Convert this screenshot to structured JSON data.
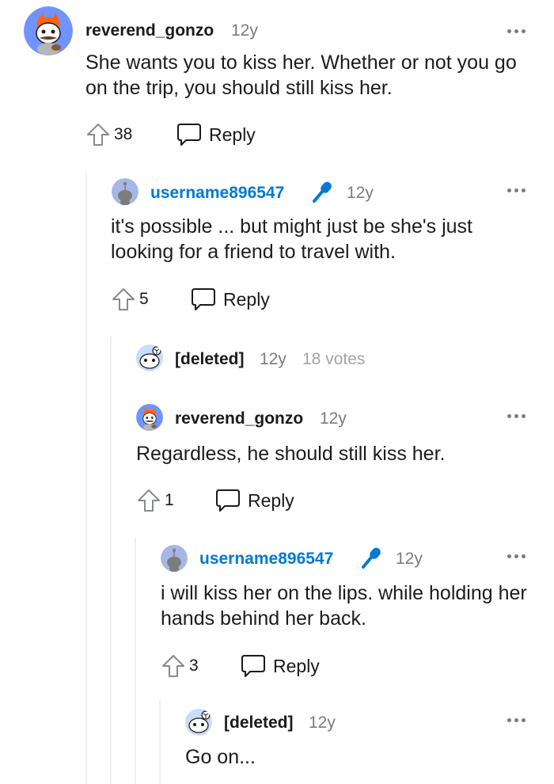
{
  "comments": [
    {
      "username": "reverend_gonzo",
      "time": "12y",
      "body": "She wants you to kiss her. Whether or not you go on the trip, you should still kiss her.",
      "votes": "38",
      "reply_label": "Reply",
      "avatar": "gonzo-avatar"
    },
    {
      "username": "username896547",
      "time": "12y",
      "body": "it's possible ... but might just be she's just looking for a friend to travel with.",
      "votes": "5",
      "reply_label": "Reply",
      "avatar": "snoo-avatar",
      "op": true,
      "flair_icon": "microphone-icon"
    },
    {
      "username": "[deleted]",
      "time": "12y",
      "votes_note": "18 votes",
      "avatar": "deleted-snoo-avatar"
    },
    {
      "username": "reverend_gonzo",
      "time": "12y",
      "body": "Regardless, he should still kiss her.",
      "votes": "1",
      "reply_label": "Reply",
      "avatar": "gonzo-avatar"
    },
    {
      "username": "username896547",
      "time": "12y",
      "body": "i will kiss her on the lips. while holding her hands behind her back.",
      "votes": "3",
      "reply_label": "Reply",
      "avatar": "snoo-avatar",
      "op": true,
      "flair_icon": "microphone-icon"
    },
    {
      "username": "[deleted]",
      "time": "12y",
      "body": "Go on...",
      "avatar": "deleted-snoo-avatar"
    }
  ],
  "colors": {
    "op_name": "#0079d3",
    "meta": "#7c7c7c",
    "thread_line": "#edeff1",
    "mic": "#0079d3"
  }
}
